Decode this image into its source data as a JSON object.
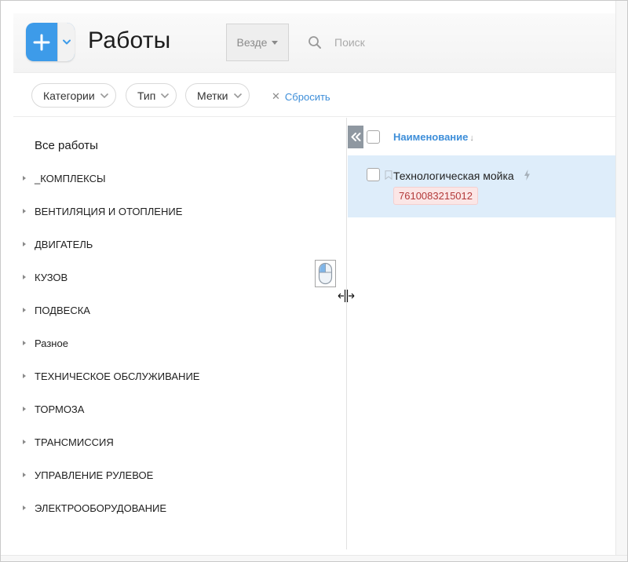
{
  "header": {
    "title": "Работы",
    "add_icon": "plus-icon",
    "add_menu_icon": "chevron-down-icon",
    "scope": {
      "selected": "Везде"
    },
    "search": {
      "placeholder": "Поиск",
      "value": ""
    }
  },
  "filters": {
    "chips": [
      {
        "label": "Категории"
      },
      {
        "label": "Тип"
      },
      {
        "label": "Метки"
      }
    ],
    "reset_label": "Сбросить"
  },
  "tree": {
    "root": "Все работы",
    "items": [
      {
        "label": "_КОМПЛЕКСЫ"
      },
      {
        "label": "ВЕНТИЛЯЦИЯ И ОТОПЛЕНИЕ"
      },
      {
        "label": "ДВИГАТЕЛЬ"
      },
      {
        "label": "КУЗОВ"
      },
      {
        "label": "ПОДВЕСКА"
      },
      {
        "label": "Разное"
      },
      {
        "label": "ТЕХНИЧЕСКОЕ ОБСЛУЖИВАНИЕ"
      },
      {
        "label": "ТОРМОЗА"
      },
      {
        "label": "ТРАНСМИССИЯ"
      },
      {
        "label": "УПРАВЛЕНИЕ РУЛЕВОЕ"
      },
      {
        "label": "ЭЛЕКТРООБОРУДОВАНИЕ"
      }
    ]
  },
  "list": {
    "column_name": "Наименование",
    "sort_indicator": "↓",
    "rows": [
      {
        "title": "Технологическая мойка",
        "tag": "7610083215012"
      }
    ]
  },
  "colors": {
    "accent": "#3d9be9",
    "link": "#3d8ed9",
    "row_selected": "#deedfa",
    "tag_bg": "#fbe6e6",
    "tag_text": "#b33a3a"
  }
}
